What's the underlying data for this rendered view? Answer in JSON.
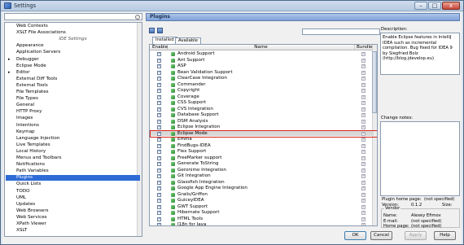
{
  "window": {
    "title": "Settings",
    "min_glyph": "–",
    "max_glyph": "□",
    "close_glyph": "x"
  },
  "left": {
    "tree_items": [
      {
        "label": "Web Contexts",
        "type": "item"
      },
      {
        "label": "XSLT File Associations",
        "type": "item"
      },
      {
        "label": "IDE Settings",
        "type": "header"
      },
      {
        "label": "Appearance",
        "type": "item"
      },
      {
        "label": "Application Servers",
        "type": "item"
      },
      {
        "label": "Debugger",
        "type": "expandable"
      },
      {
        "label": "Eclipse Mode",
        "type": "item"
      },
      {
        "label": "Editor",
        "type": "expandable"
      },
      {
        "label": "External Diff Tools",
        "type": "item"
      },
      {
        "label": "External Tools",
        "type": "item"
      },
      {
        "label": "File Templates",
        "type": "item"
      },
      {
        "label": "File Types",
        "type": "item"
      },
      {
        "label": "General",
        "type": "item"
      },
      {
        "label": "HTTP Proxy",
        "type": "item"
      },
      {
        "label": "Images",
        "type": "item"
      },
      {
        "label": "Intentions",
        "type": "item"
      },
      {
        "label": "Keymap",
        "type": "item"
      },
      {
        "label": "Language Injection",
        "type": "item"
      },
      {
        "label": "Live Templates",
        "type": "item"
      },
      {
        "label": "Local History",
        "type": "item"
      },
      {
        "label": "Menus and Toolbars",
        "type": "item"
      },
      {
        "label": "Notifications",
        "type": "item"
      },
      {
        "label": "Path Variables",
        "type": "item"
      },
      {
        "label": "Plugins",
        "type": "selected"
      },
      {
        "label": "Quick Lists",
        "type": "item"
      },
      {
        "label": "TODO",
        "type": "item"
      },
      {
        "label": "UML",
        "type": "item"
      },
      {
        "label": "Updates",
        "type": "item"
      },
      {
        "label": "Web Browsers",
        "type": "item"
      },
      {
        "label": "Web Services",
        "type": "item"
      },
      {
        "label": "XPath Viewer",
        "type": "item"
      },
      {
        "label": "XSLT",
        "type": "item"
      }
    ]
  },
  "plugins": {
    "header": "Plugins",
    "tabs": [
      "Installed",
      "Available"
    ],
    "columns": {
      "enable": "Enable",
      "name": "Name",
      "bundled": "Bundled"
    },
    "rows": [
      "Android Support",
      "Ant Support",
      "ASP",
      "Bean Validation Support",
      "ClearCase Integration",
      "Commander",
      "Copyright",
      "Coverage",
      "CSS Support",
      "CVS Integration",
      "Database Support",
      "DSM Analysis",
      "Eclipse Integration",
      "Eclipse Mode",
      "Emma",
      "FindBugs-IDEA",
      "Flex Support",
      "FreeMarker support",
      "Generate ToString",
      "Geronimo Integration",
      "Git Integration",
      "Glassfish Integration",
      "Google App Engine Integration",
      "Grails/Griffon",
      "GuiceyIDEA",
      "GWT Support",
      "Hibernate Support",
      "HTML Tools",
      "I18n for Java"
    ],
    "selected_row": "Eclipse Mode",
    "check_glyph": "✓"
  },
  "details": {
    "description_label": "Description:",
    "description_text": "Enable Eclipse features in IntelliJ IDEA such as incremental compilation. Bug fixed for IDEA 9 by Siegfried Bolz (http://blog.jdevelop.eu)",
    "change_notes_label": "Change notes:",
    "homepage_label": "Plugin home page:",
    "homepage_value": "(not specified)",
    "version_label": "Version:",
    "version_value": "0.1.2",
    "size_label": "Size:",
    "vendor_label": "Vendor",
    "name_label": "Name:",
    "name_value": "Alexey Efimov",
    "email_label": "E-mail:",
    "email_value": "(not specified)",
    "home_label": "Home page:",
    "home_value": "(not specified)"
  },
  "buttons": {
    "ok": "OK",
    "cancel": "Cancel",
    "apply": "Apply",
    "help": "Help"
  }
}
